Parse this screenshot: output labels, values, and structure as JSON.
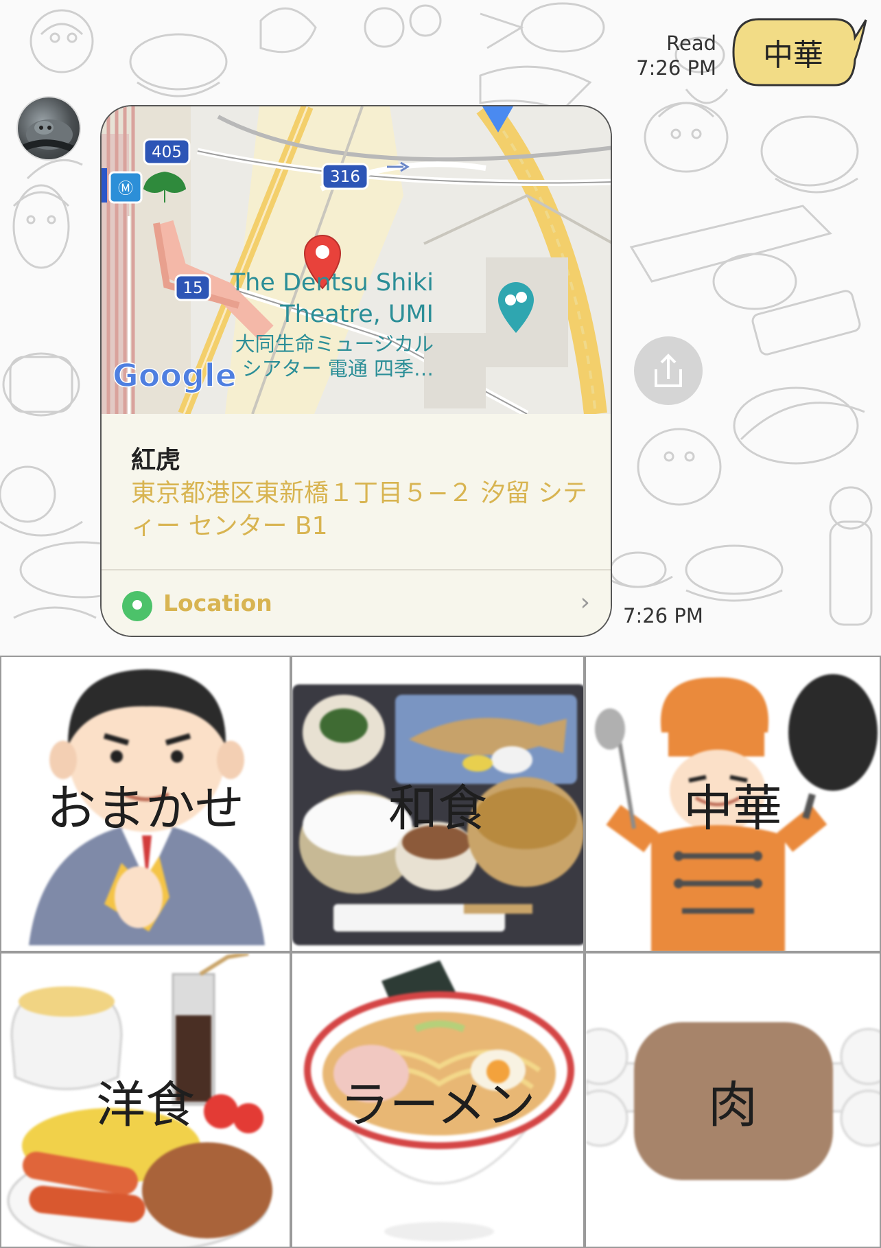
{
  "chat": {
    "outgoing_message": {
      "text": "中華",
      "read_label": "Read",
      "time": "7:26 PM"
    },
    "incoming_location": {
      "map": {
        "route_badges": [
          "405",
          "316",
          "15"
        ],
        "poi_label_en_line1": "The Dentsu Shiki",
        "poi_label_en_line2": "Theatre, UMI",
        "poi_label_jp_line1": "大同生命ミュージカル",
        "poi_label_jp_line2": "シアター 電通 四季…",
        "logo": "Google"
      },
      "place_name": "紅虎",
      "address": "東京都港区東新橋１丁目５−２ 汐留 シティー センター B1",
      "location_label": "Location",
      "chevron": "›",
      "time": "7:26 PM"
    }
  },
  "icons": {
    "share": "share-icon",
    "location": "location-pin-icon",
    "avatar": "avatar"
  },
  "menu": {
    "items": [
      {
        "label": "おまかせ"
      },
      {
        "label": "和食"
      },
      {
        "label": "中華"
      },
      {
        "label": "洋食"
      },
      {
        "label": "ラーメン"
      },
      {
        "label": "肉"
      }
    ]
  },
  "colors": {
    "outgoing_bubble": "#f2dc86",
    "accent_gold": "#d8b451",
    "map_pin": "#e8423b",
    "location_green": "#4cc26a"
  }
}
